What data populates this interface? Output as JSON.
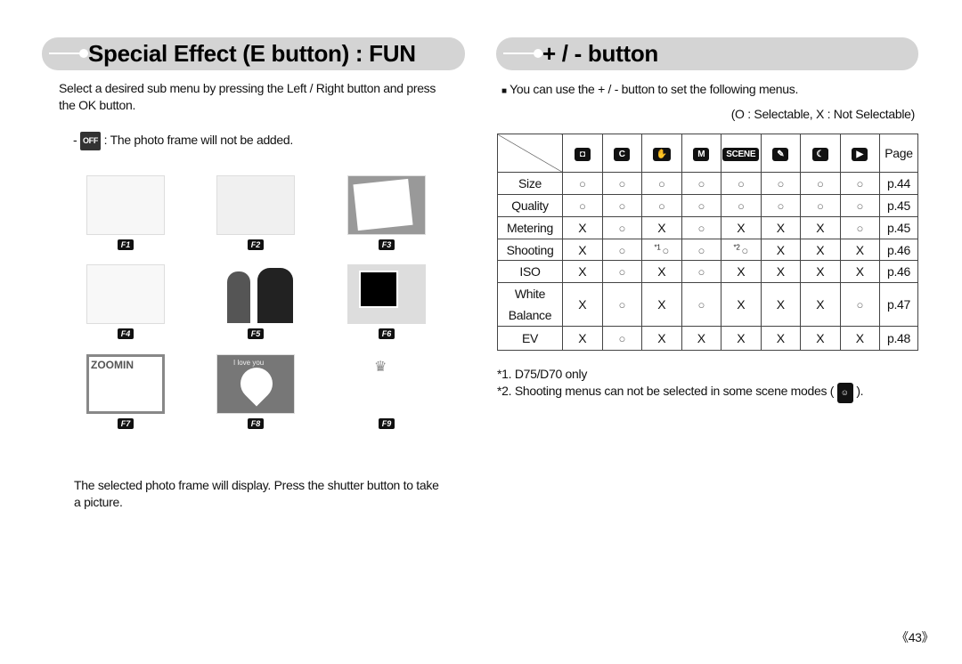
{
  "left": {
    "title": "Special Effect (E button) : FUN",
    "intro": "Select a desired sub menu by pressing the Left / Right button and press the OK button.",
    "off_dash": "-",
    "off_icon": "OFF",
    "off_text": ": The photo frame will not be added.",
    "frames": [
      {
        "label": "F1",
        "style": "paper-curl"
      },
      {
        "label": "F2",
        "style": "taped"
      },
      {
        "label": "F3",
        "style": "tilted-polaroid"
      },
      {
        "label": "F4",
        "style": "speech-bubbles"
      },
      {
        "label": "F5",
        "style": "couple"
      },
      {
        "label": "F6",
        "style": "window"
      },
      {
        "label": "F7",
        "style": "zoomin",
        "text": "ZOOMIN"
      },
      {
        "label": "F8",
        "style": "heart",
        "text": "I love you"
      },
      {
        "label": "F9",
        "style": "angel-crown"
      }
    ],
    "footer": "The selected photo frame will display. Press the shutter button to take a picture."
  },
  "right": {
    "title": "+ / - button",
    "bullet": "■",
    "intro": "You can use the + / - button to set the following menus.",
    "legend": "(O : Selectable, X : Not Selectable)",
    "table": {
      "headers": [
        "camera-icon",
        "program-icon",
        "dis-icon",
        "manual-icon",
        "SCENE",
        "portrait-icon",
        "night-icon",
        "movie-icon",
        "Page"
      ],
      "header_glyphs": [
        "◘",
        "C",
        "✋",
        "M",
        "SCENE",
        "✎",
        "☾",
        "▶"
      ],
      "rows": [
        {
          "label": "Size",
          "cells": [
            "○",
            "○",
            "○",
            "○",
            "○",
            "○",
            "○",
            "○"
          ],
          "page": "p.44"
        },
        {
          "label": "Quality",
          "cells": [
            "○",
            "○",
            "○",
            "○",
            "○",
            "○",
            "○",
            "○"
          ],
          "page": "p.45"
        },
        {
          "label": "Metering",
          "cells": [
            "X",
            "○",
            "X",
            "○",
            "X",
            "X",
            "X",
            "○"
          ],
          "page": "p.45"
        },
        {
          "label": "Shooting",
          "cells": [
            "X",
            "○",
            "○",
            "○",
            "○",
            "X",
            "X",
            "X"
          ],
          "page": "p.46",
          "notes": {
            "2": "*1",
            "4": "*2"
          }
        },
        {
          "label": "ISO",
          "cells": [
            "X",
            "○",
            "X",
            "○",
            "X",
            "X",
            "X",
            "X"
          ],
          "page": "p.46"
        },
        {
          "label": "White Balance",
          "cells": [
            "X",
            "○",
            "X",
            "○",
            "X",
            "X",
            "X",
            "○"
          ],
          "page": "p.47"
        },
        {
          "label": "EV",
          "cells": [
            "X",
            "○",
            "X",
            "X",
            "X",
            "X",
            "X",
            "X"
          ],
          "page": "p.48"
        }
      ]
    },
    "note1": "*1. D75/D70 only",
    "note2": "*2. Shooting menus can not be selected in some scene modes (",
    "note2_end": ").",
    "note2_icon": "scene-mode-icon"
  },
  "page_number": "《43》"
}
